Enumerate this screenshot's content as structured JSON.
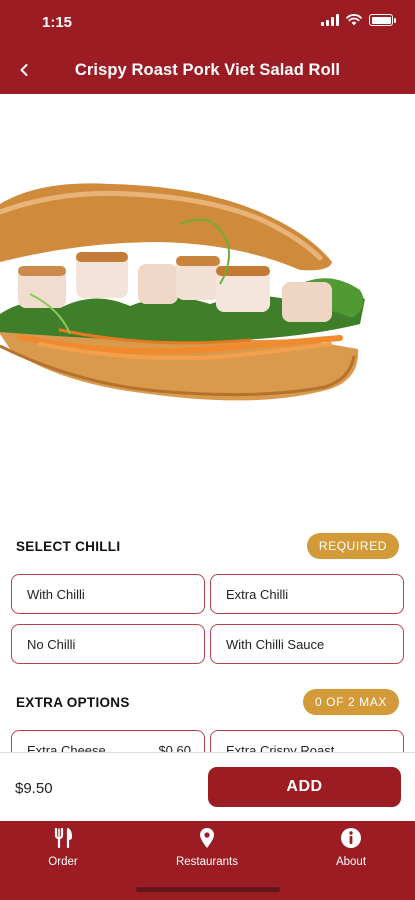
{
  "status_bar": {
    "time": "1:15"
  },
  "header": {
    "title": "Crispy Roast Pork Viet Salad Roll"
  },
  "sections": [
    {
      "title": "SELECT CHILLI",
      "badge": "REQUIRED",
      "options": [
        {
          "label": "With Chilli"
        },
        {
          "label": "Extra Chilli"
        },
        {
          "label": "No Chilli"
        },
        {
          "label": "With Chilli Sauce"
        }
      ]
    },
    {
      "title": "EXTRA OPTIONS",
      "badge": "0 OF 2 MAX",
      "options": [
        {
          "label": "Extra Cheese",
          "price": "$0.60"
        },
        {
          "label": "Extra Crispy Roast"
        }
      ]
    }
  ],
  "footer": {
    "price": "$9.50",
    "add_label": "ADD"
  },
  "tabbar": {
    "tabs": [
      {
        "label": "Order",
        "icon": "fork-knife-icon"
      },
      {
        "label": "Restaurants",
        "icon": "map-pin-icon"
      },
      {
        "label": "About",
        "icon": "info-icon"
      }
    ]
  },
  "colors": {
    "brand": "#9b1c23",
    "badge": "#d39a3a",
    "option_border": "#b44249"
  }
}
